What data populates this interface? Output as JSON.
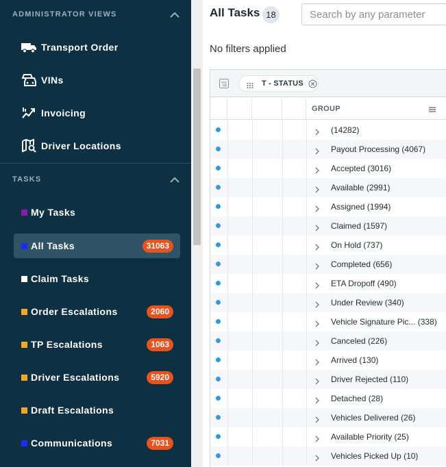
{
  "sidebar": {
    "admin_section": "ADMINISTRATOR VIEWS",
    "admin_items": [
      {
        "label": "Transport Order",
        "icon": "truck-icon"
      },
      {
        "label": "VINs",
        "icon": "cars-icon"
      },
      {
        "label": "Invoicing",
        "icon": "invoice-icon"
      },
      {
        "label": "Driver Locations",
        "icon": "map-search-icon"
      }
    ],
    "tasks_section": "TASKS",
    "task_items": [
      {
        "label": "My Tasks",
        "color": "#8b1aa8",
        "badge": ""
      },
      {
        "label": "All Tasks",
        "color": "#1a2cff",
        "badge": "31063",
        "active": true
      },
      {
        "label": "Claim Tasks",
        "color": "#ffffff",
        "badge": ""
      },
      {
        "label": "Order Escalations",
        "color": "#f5a623",
        "badge": "2060"
      },
      {
        "label": "TP Escalations",
        "color": "#f5a623",
        "badge": "1063"
      },
      {
        "label": "Driver Escalations",
        "color": "#f5a623",
        "badge": "5920"
      },
      {
        "label": "Draft Escalations",
        "color": "#f5a623",
        "badge": ""
      },
      {
        "label": "Communications",
        "color": "#1a2cff",
        "badge": "7031"
      }
    ]
  },
  "main": {
    "title": "All Tasks",
    "count": "18",
    "search_placeholder": "Search by any parameter",
    "filters_text": "No filters applied",
    "group_chip": "T - STATUS",
    "group_header": "GROUP",
    "rows": [
      {
        "label": "",
        "count": "(14282)"
      },
      {
        "label": "Payout Processing",
        "count": "(4067)"
      },
      {
        "label": "Accepted",
        "count": "(3016)"
      },
      {
        "label": "Available",
        "count": "(2991)"
      },
      {
        "label": "Assigned",
        "count": "(1994)"
      },
      {
        "label": "Claimed",
        "count": "(1597)"
      },
      {
        "label": "On Hold",
        "count": "(737)"
      },
      {
        "label": "Completed",
        "count": "(656)"
      },
      {
        "label": "ETA Dropoff",
        "count": "(490)"
      },
      {
        "label": "Under Review",
        "count": "(340)"
      },
      {
        "label": "Vehicle Signature Pic...",
        "count": "(338)"
      },
      {
        "label": "Canceled",
        "count": "(226)"
      },
      {
        "label": "Arrived",
        "count": "(130)"
      },
      {
        "label": "Driver Rejected",
        "count": "(110)"
      },
      {
        "label": "Detached",
        "count": "(28)"
      },
      {
        "label": "Vehicles Delivered",
        "count": "(26)"
      },
      {
        "label": "Available Priority",
        "count": "(25)"
      },
      {
        "label": "Vehicles Picked Up",
        "count": "(10)"
      }
    ]
  },
  "colors": {
    "sidebar_bg": "#0d3042",
    "active_bg": "#2f5466",
    "badge": "#e8521c",
    "row_dot": "#2c9be0"
  }
}
